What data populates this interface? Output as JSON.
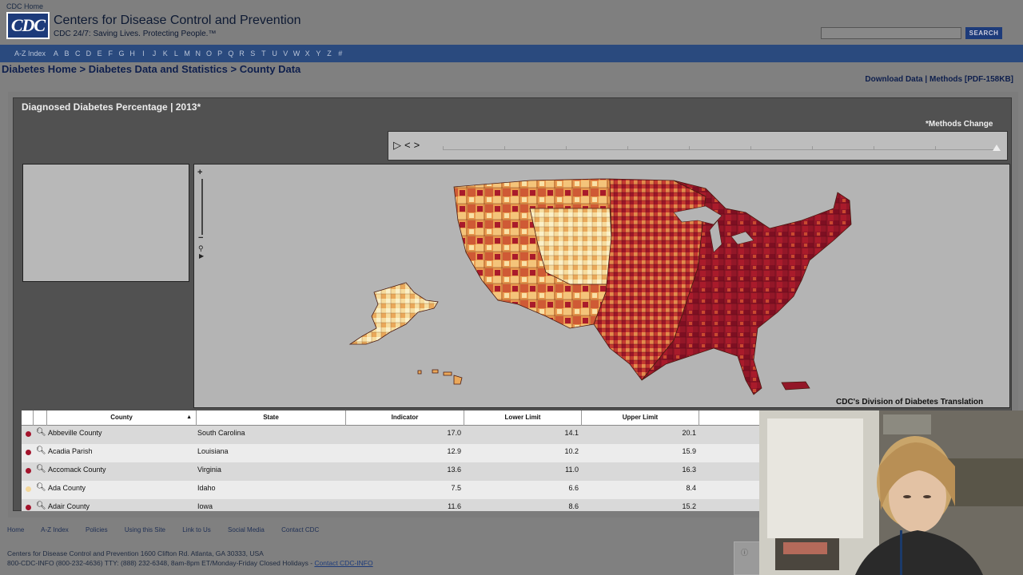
{
  "header": {
    "cdc_home": "CDC Home",
    "logo_text": "CDC",
    "org_name": "Centers for Disease Control and Prevention",
    "tagline": "CDC 24/7: Saving Lives. Protecting People.™",
    "search_placeholder": "",
    "search_label": "SEARCH"
  },
  "az_bar": {
    "title": "A-Z Index",
    "letters": [
      "A",
      "B",
      "C",
      "D",
      "E",
      "F",
      "G",
      "H",
      "I",
      "J",
      "K",
      "L",
      "M",
      "N",
      "O",
      "P",
      "Q",
      "R",
      "S",
      "T",
      "U",
      "V",
      "W",
      "X",
      "Y",
      "Z",
      "#"
    ]
  },
  "breadcrumb": {
    "items": [
      "Diabetes Home",
      "Diabetes Data and Statistics",
      "County Data"
    ],
    "separator": " > "
  },
  "tools": {
    "download": "Download Data",
    "divider": " | ",
    "methods": "Methods [PDF-158KB]"
  },
  "panel": {
    "title": "Diagnosed Diabetes Percentage | 2013*",
    "methods_change": "*Methods Change",
    "controls": [
      "▷",
      "<",
      ">"
    ],
    "credit": "CDC's Division of Diabetes Translation"
  },
  "map_colors": {
    "lowest": "#f9e7b4",
    "low": "#f0b15e",
    "mid": "#cf5a35",
    "high": "#a91b2b",
    "highest": "#7e0f22"
  },
  "table": {
    "columns": [
      "County",
      "State",
      "Indicator",
      "Lower Limit",
      "Upper Limit"
    ],
    "sort_indicator": "▲",
    "rows": [
      {
        "county": "Abbeville County",
        "state": "South Carolina",
        "indicator": "17.0",
        "lower": "14.1",
        "upper": "20.1",
        "color": "#a3142c"
      },
      {
        "county": "Acadia Parish",
        "state": "Louisiana",
        "indicator": "12.9",
        "lower": "10.2",
        "upper": "15.9",
        "color": "#a3142c"
      },
      {
        "county": "Accomack County",
        "state": "Virginia",
        "indicator": "13.6",
        "lower": "11.0",
        "upper": "16.3",
        "color": "#a3142c"
      },
      {
        "county": "Ada County",
        "state": "Idaho",
        "indicator": "7.5",
        "lower": "6.6",
        "upper": "8.4",
        "color": "#f4d79a"
      },
      {
        "county": "Adair County",
        "state": "Iowa",
        "indicator": "11.6",
        "lower": "8.6",
        "upper": "15.2",
        "color": "#a3142c"
      }
    ]
  },
  "footer": {
    "links": [
      "Home",
      "A-Z Index",
      "Policies",
      "Using this Site",
      "Link to Us",
      "Social Media",
      "Contact CDC"
    ],
    "address": "Centers for Disease Control and Prevention   1600 Clifton Rd. Atlanta, GA 30333, USA",
    "phones": "800-CDC-INFO (800-232-4636) TTY: (888) 232-6348, 8am-8pm ET/Monday-Friday Closed Holidays - ",
    "contact_link": "Contact CDC-INFO"
  }
}
